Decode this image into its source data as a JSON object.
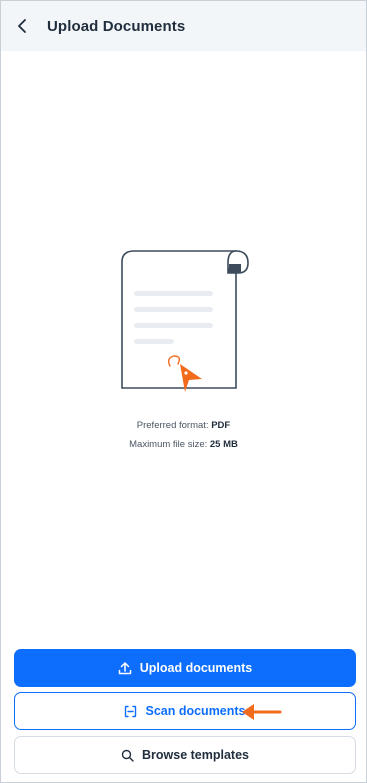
{
  "header": {
    "back_icon": "chevron-left-icon",
    "title": "Upload Documents"
  },
  "info": {
    "format_label": "Preferred format:",
    "format_value": "PDF",
    "size_label": "Maximum file size:",
    "size_value": "25 MB"
  },
  "actions": {
    "upload_label": "Upload documents",
    "upload_icon": "upload-icon",
    "scan_label": "Scan documents",
    "scan_icon": "scan-icon",
    "browse_label": "Browse templates",
    "browse_icon": "search-icon"
  },
  "colors": {
    "primary": "#0d6efd",
    "accent": "#f26b1d",
    "header_bg": "#f3f6f9",
    "text": "#1f2d3d"
  }
}
